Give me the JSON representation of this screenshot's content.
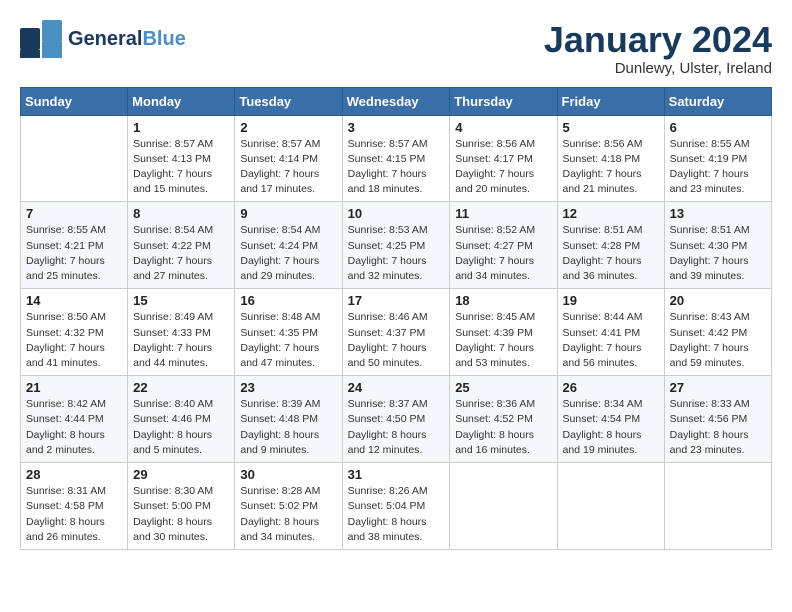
{
  "header": {
    "logo_general": "General",
    "logo_blue": "Blue",
    "month_title": "January 2024",
    "location": "Dunlewy, Ulster, Ireland"
  },
  "days_of_week": [
    "Sunday",
    "Monday",
    "Tuesday",
    "Wednesday",
    "Thursday",
    "Friday",
    "Saturday"
  ],
  "weeks": [
    [
      {
        "day": "",
        "sunrise": "",
        "sunset": "",
        "daylight": ""
      },
      {
        "day": "1",
        "sunrise": "Sunrise: 8:57 AM",
        "sunset": "Sunset: 4:13 PM",
        "daylight": "Daylight: 7 hours and 15 minutes."
      },
      {
        "day": "2",
        "sunrise": "Sunrise: 8:57 AM",
        "sunset": "Sunset: 4:14 PM",
        "daylight": "Daylight: 7 hours and 17 minutes."
      },
      {
        "day": "3",
        "sunrise": "Sunrise: 8:57 AM",
        "sunset": "Sunset: 4:15 PM",
        "daylight": "Daylight: 7 hours and 18 minutes."
      },
      {
        "day": "4",
        "sunrise": "Sunrise: 8:56 AM",
        "sunset": "Sunset: 4:17 PM",
        "daylight": "Daylight: 7 hours and 20 minutes."
      },
      {
        "day": "5",
        "sunrise": "Sunrise: 8:56 AM",
        "sunset": "Sunset: 4:18 PM",
        "daylight": "Daylight: 7 hours and 21 minutes."
      },
      {
        "day": "6",
        "sunrise": "Sunrise: 8:55 AM",
        "sunset": "Sunset: 4:19 PM",
        "daylight": "Daylight: 7 hours and 23 minutes."
      }
    ],
    [
      {
        "day": "7",
        "sunrise": "Sunrise: 8:55 AM",
        "sunset": "Sunset: 4:21 PM",
        "daylight": "Daylight: 7 hours and 25 minutes."
      },
      {
        "day": "8",
        "sunrise": "Sunrise: 8:54 AM",
        "sunset": "Sunset: 4:22 PM",
        "daylight": "Daylight: 7 hours and 27 minutes."
      },
      {
        "day": "9",
        "sunrise": "Sunrise: 8:54 AM",
        "sunset": "Sunset: 4:24 PM",
        "daylight": "Daylight: 7 hours and 29 minutes."
      },
      {
        "day": "10",
        "sunrise": "Sunrise: 8:53 AM",
        "sunset": "Sunset: 4:25 PM",
        "daylight": "Daylight: 7 hours and 32 minutes."
      },
      {
        "day": "11",
        "sunrise": "Sunrise: 8:52 AM",
        "sunset": "Sunset: 4:27 PM",
        "daylight": "Daylight: 7 hours and 34 minutes."
      },
      {
        "day": "12",
        "sunrise": "Sunrise: 8:51 AM",
        "sunset": "Sunset: 4:28 PM",
        "daylight": "Daylight: 7 hours and 36 minutes."
      },
      {
        "day": "13",
        "sunrise": "Sunrise: 8:51 AM",
        "sunset": "Sunset: 4:30 PM",
        "daylight": "Daylight: 7 hours and 39 minutes."
      }
    ],
    [
      {
        "day": "14",
        "sunrise": "Sunrise: 8:50 AM",
        "sunset": "Sunset: 4:32 PM",
        "daylight": "Daylight: 7 hours and 41 minutes."
      },
      {
        "day": "15",
        "sunrise": "Sunrise: 8:49 AM",
        "sunset": "Sunset: 4:33 PM",
        "daylight": "Daylight: 7 hours and 44 minutes."
      },
      {
        "day": "16",
        "sunrise": "Sunrise: 8:48 AM",
        "sunset": "Sunset: 4:35 PM",
        "daylight": "Daylight: 7 hours and 47 minutes."
      },
      {
        "day": "17",
        "sunrise": "Sunrise: 8:46 AM",
        "sunset": "Sunset: 4:37 PM",
        "daylight": "Daylight: 7 hours and 50 minutes."
      },
      {
        "day": "18",
        "sunrise": "Sunrise: 8:45 AM",
        "sunset": "Sunset: 4:39 PM",
        "daylight": "Daylight: 7 hours and 53 minutes."
      },
      {
        "day": "19",
        "sunrise": "Sunrise: 8:44 AM",
        "sunset": "Sunset: 4:41 PM",
        "daylight": "Daylight: 7 hours and 56 minutes."
      },
      {
        "day": "20",
        "sunrise": "Sunrise: 8:43 AM",
        "sunset": "Sunset: 4:42 PM",
        "daylight": "Daylight: 7 hours and 59 minutes."
      }
    ],
    [
      {
        "day": "21",
        "sunrise": "Sunrise: 8:42 AM",
        "sunset": "Sunset: 4:44 PM",
        "daylight": "Daylight: 8 hours and 2 minutes."
      },
      {
        "day": "22",
        "sunrise": "Sunrise: 8:40 AM",
        "sunset": "Sunset: 4:46 PM",
        "daylight": "Daylight: 8 hours and 5 minutes."
      },
      {
        "day": "23",
        "sunrise": "Sunrise: 8:39 AM",
        "sunset": "Sunset: 4:48 PM",
        "daylight": "Daylight: 8 hours and 9 minutes."
      },
      {
        "day": "24",
        "sunrise": "Sunrise: 8:37 AM",
        "sunset": "Sunset: 4:50 PM",
        "daylight": "Daylight: 8 hours and 12 minutes."
      },
      {
        "day": "25",
        "sunrise": "Sunrise: 8:36 AM",
        "sunset": "Sunset: 4:52 PM",
        "daylight": "Daylight: 8 hours and 16 minutes."
      },
      {
        "day": "26",
        "sunrise": "Sunrise: 8:34 AM",
        "sunset": "Sunset: 4:54 PM",
        "daylight": "Daylight: 8 hours and 19 minutes."
      },
      {
        "day": "27",
        "sunrise": "Sunrise: 8:33 AM",
        "sunset": "Sunset: 4:56 PM",
        "daylight": "Daylight: 8 hours and 23 minutes."
      }
    ],
    [
      {
        "day": "28",
        "sunrise": "Sunrise: 8:31 AM",
        "sunset": "Sunset: 4:58 PM",
        "daylight": "Daylight: 8 hours and 26 minutes."
      },
      {
        "day": "29",
        "sunrise": "Sunrise: 8:30 AM",
        "sunset": "Sunset: 5:00 PM",
        "daylight": "Daylight: 8 hours and 30 minutes."
      },
      {
        "day": "30",
        "sunrise": "Sunrise: 8:28 AM",
        "sunset": "Sunset: 5:02 PM",
        "daylight": "Daylight: 8 hours and 34 minutes."
      },
      {
        "day": "31",
        "sunrise": "Sunrise: 8:26 AM",
        "sunset": "Sunset: 5:04 PM",
        "daylight": "Daylight: 8 hours and 38 minutes."
      },
      {
        "day": "",
        "sunrise": "",
        "sunset": "",
        "daylight": ""
      },
      {
        "day": "",
        "sunrise": "",
        "sunset": "",
        "daylight": ""
      },
      {
        "day": "",
        "sunrise": "",
        "sunset": "",
        "daylight": ""
      }
    ]
  ]
}
